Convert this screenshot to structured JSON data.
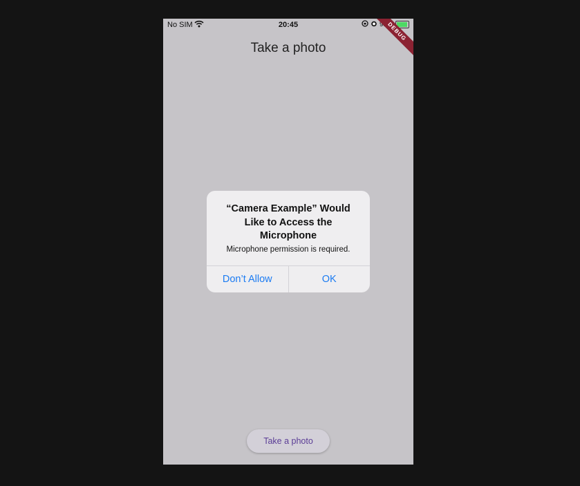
{
  "status_bar": {
    "carrier": "No SIM",
    "time": "20:45",
    "battery_percent": "91%",
    "battery_level": 0.91,
    "icons": [
      "wifi-icon",
      "screen-rotation-lock-icon",
      "alarm-icon",
      "battery-charging-icon"
    ]
  },
  "app_bar": {
    "title": "Take a photo"
  },
  "debug_banner": {
    "label": "DEBUG",
    "color": "#8b2232"
  },
  "dialog": {
    "title": "“Camera Example” Would Like to Access the Microphone",
    "message": "Microphone permission is required.",
    "buttons": {
      "deny": "Don’t Allow",
      "allow": "OK"
    },
    "button_color": "#1b7bf2"
  },
  "primary_button": {
    "label": "Take a photo",
    "text_color": "#5b3d96"
  }
}
